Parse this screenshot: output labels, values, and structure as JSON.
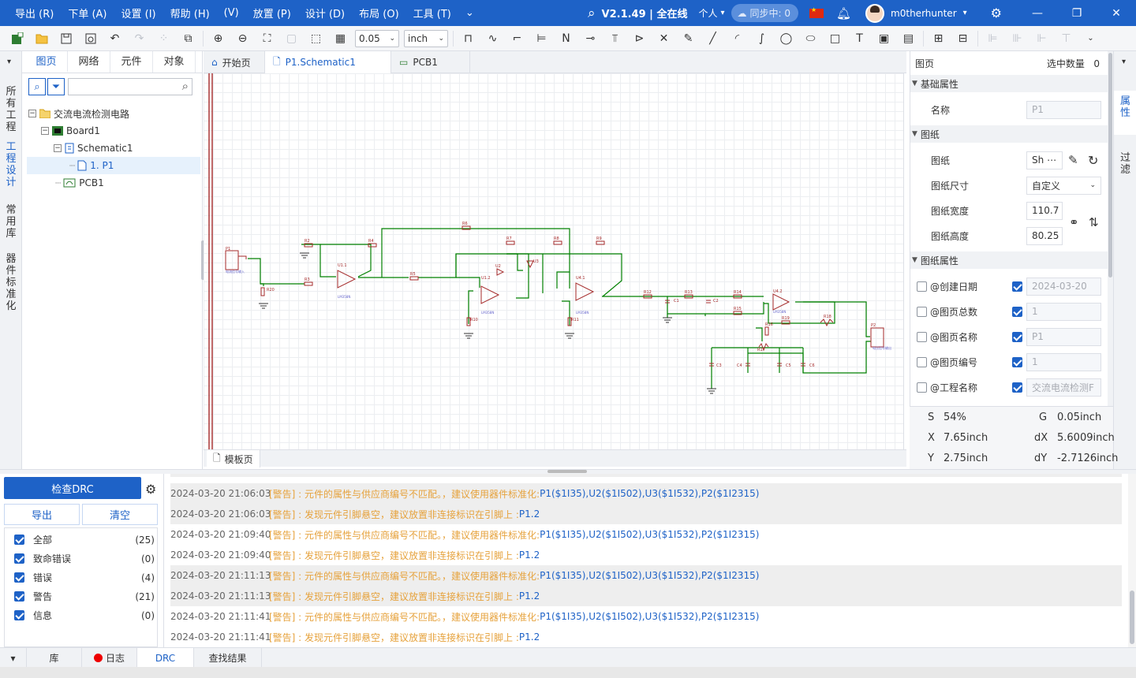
{
  "menu": [
    "导出 (R)",
    "下单 (A)",
    "设置 (I)",
    "帮助 (H)",
    "(V)",
    "放置 (P)",
    "设计 (D)",
    "布局 (O)",
    "工具 (T)"
  ],
  "header": {
    "version": "V2.1.49 | 全在线",
    "mode": "个人",
    "sync": "同步中: 0",
    "username": "m0therhunter"
  },
  "toolbar": {
    "grid": "0.05",
    "unit": "inch"
  },
  "left_vtabs": [
    "所有工程",
    "工程设计",
    "常用库",
    "器件标准化"
  ],
  "left_tabs": [
    "图页",
    "网络",
    "元件",
    "对象"
  ],
  "tree": [
    "交流电流检测电路",
    "Board1",
    "Schematic1",
    "1. P1",
    "PCB1"
  ],
  "doc_tabs": [
    "开始页",
    "P1.Schematic1",
    "PCB1"
  ],
  "bottom_doc_tab": "模板页",
  "props": {
    "head": "图页",
    "sel_label": "选中数量",
    "sel_count": "0",
    "sec_basic": "基础属性",
    "name_label": "名称",
    "name_value": "P1",
    "sec_sheet": "图纸",
    "sheet_label": "图纸",
    "sheet_value": "Sh",
    "size_label": "图纸尺寸",
    "size_value": "自定义",
    "width_label": "图纸宽度",
    "width_value": "110.7",
    "height_label": "图纸高度",
    "height_value": "80.25",
    "sec_attr": "图纸属性",
    "attrs": [
      {
        "label": "@创建日期",
        "value": "2024-03-20"
      },
      {
        "label": "@图页总数",
        "value": "1"
      },
      {
        "label": "@图页名称",
        "value": "P1"
      },
      {
        "label": "@图页编号",
        "value": "1"
      },
      {
        "label": "@工程名称",
        "value": "交流电流检测F"
      }
    ]
  },
  "right_vtabs": [
    "属性",
    "过滤"
  ],
  "coords": {
    "s_label": "S",
    "s": "54%",
    "g_label": "G",
    "g": "0.05inch",
    "x_label": "X",
    "x": "7.65inch",
    "dx_label": "dX",
    "dx": "5.6009inch",
    "y_label": "Y",
    "y": "2.75inch",
    "dy_label": "dY",
    "dy": "-2.7126inch"
  },
  "drc": {
    "check": "检查DRC",
    "export": "导出",
    "clear": "清空",
    "filters": [
      {
        "label": "全部",
        "count": "(25)"
      },
      {
        "label": "致命错误",
        "count": "(0)"
      },
      {
        "label": "错误",
        "count": "(4)"
      },
      {
        "label": "警告",
        "count": "(21)"
      },
      {
        "label": "信息",
        "count": "(0)"
      }
    ]
  },
  "log": [
    {
      "ts": "2024-03-20 21:06:03",
      "msg": "[警告] : 元件的属性与供应商编号不匹配。，建议使用器件标准化: ",
      "link": "P1($1I35),U2($1I502),U3($1I532),P2($1I2315)"
    },
    {
      "ts": "2024-03-20 21:06:03",
      "msg": "[警告] : 发现元件引脚悬空，建议放置非连接标识在引脚上 : ",
      "link": "P1.2"
    },
    {
      "ts": "2024-03-20 21:09:40",
      "msg": "[警告] : 元件的属性与供应商编号不匹配。，建议使用器件标准化: ",
      "link": "P1($1I35),U2($1I502),U3($1I532),P2($1I2315)"
    },
    {
      "ts": "2024-03-20 21:09:40",
      "msg": "[警告] : 发现元件引脚悬空，建议放置非连接标识在引脚上 : ",
      "link": "P1.2"
    },
    {
      "ts": "2024-03-20 21:11:13",
      "msg": "[警告] : 元件的属性与供应商编号不匹配。，建议使用器件标准化: ",
      "link": "P1($1I35),U2($1I502),U3($1I532),P2($1I2315)"
    },
    {
      "ts": "2024-03-20 21:11:13",
      "msg": "[警告] : 发现元件引脚悬空，建议放置非连接标识在引脚上 : ",
      "link": "P1.2"
    },
    {
      "ts": "2024-03-20 21:11:41",
      "msg": "[警告] : 元件的属性与供应商编号不匹配。，建议使用器件标准化: ",
      "link": "P1($1I35),U2($1I502),U3($1I532),P2($1I2315)"
    },
    {
      "ts": "2024-03-20 21:11:41",
      "msg": "[警告] : 发现元件引脚悬空，建议放置非连接标识在引脚上 : ",
      "link": "P1.2"
    }
  ],
  "bottom_tabs": [
    "库",
    "日志",
    "DRC",
    "查找结果"
  ],
  "colors": {
    "accent": "#1e62c7",
    "warn": "#e6a23c",
    "wire": "#008000",
    "part": "#a52a2a"
  }
}
